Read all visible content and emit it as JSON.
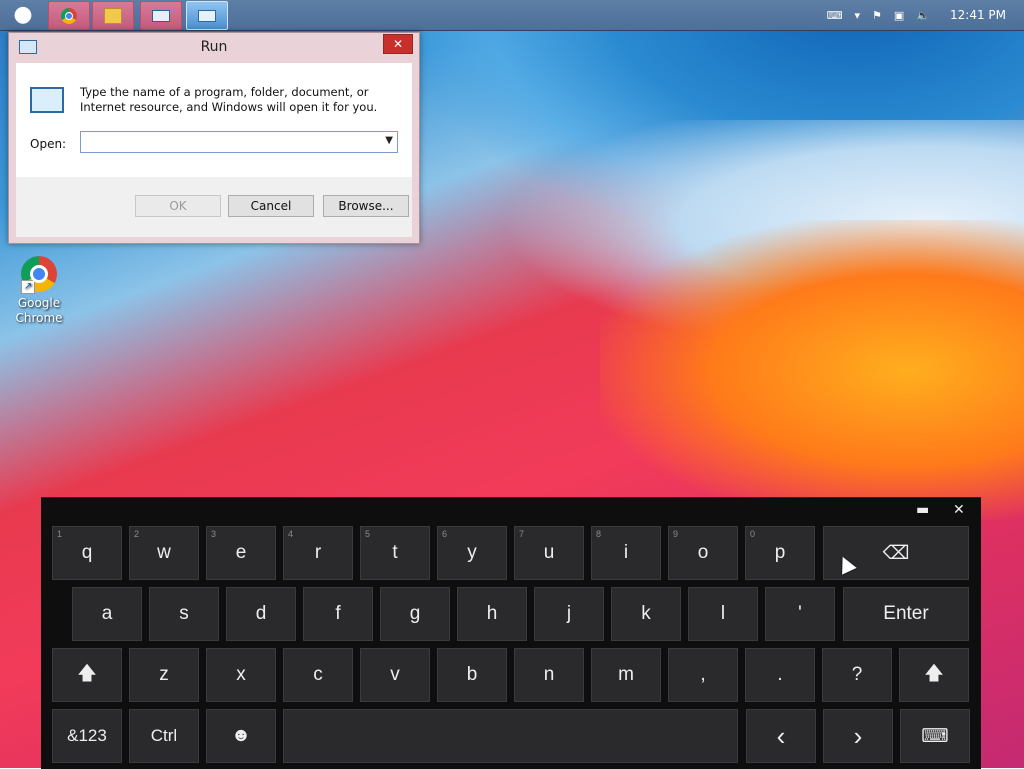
{
  "taskbar": {
    "clock": "12:41 PM",
    "tray_icons": [
      "keyboard-icon",
      "chevron-up-icon",
      "flag-icon",
      "network-icon",
      "volume-muted-icon"
    ]
  },
  "desktop": {
    "icons": [
      {
        "label_line1": "Google",
        "label_line2": "Chrome"
      }
    ]
  },
  "run_dialog": {
    "title": "Run",
    "description": "Type the name of a program, folder, document, or Internet resource, and Windows will open it for you.",
    "open_label": "Open:",
    "open_value": "",
    "ok_label": "OK",
    "cancel_label": "Cancel",
    "browse_label": "Browse..."
  },
  "keyboard": {
    "row1": [
      {
        "label": "q",
        "num": "1"
      },
      {
        "label": "w",
        "num": "2"
      },
      {
        "label": "e",
        "num": "3"
      },
      {
        "label": "r",
        "num": "4"
      },
      {
        "label": "t",
        "num": "5"
      },
      {
        "label": "y",
        "num": "6"
      },
      {
        "label": "u",
        "num": "7"
      },
      {
        "label": "i",
        "num": "8"
      },
      {
        "label": "o",
        "num": "9"
      },
      {
        "label": "p",
        "num": "0"
      }
    ],
    "row2": [
      {
        "label": "a"
      },
      {
        "label": "s"
      },
      {
        "label": "d"
      },
      {
        "label": "f"
      },
      {
        "label": "g"
      },
      {
        "label": "h"
      },
      {
        "label": "j"
      },
      {
        "label": "k"
      },
      {
        "label": "l"
      },
      {
        "label": "'"
      }
    ],
    "row3": [
      {
        "label": "z"
      },
      {
        "label": "x"
      },
      {
        "label": "c"
      },
      {
        "label": "v"
      },
      {
        "label": "b"
      },
      {
        "label": "n"
      },
      {
        "label": "m"
      },
      {
        "label": ","
      },
      {
        "label": "."
      },
      {
        "label": "?"
      }
    ],
    "enter_label": "Enter",
    "symbols_label": "&123",
    "ctrl_label": "Ctrl",
    "emoji_glyph": "☻",
    "left_glyph": "‹",
    "right_glyph": "›",
    "shift_glyph": "🡅",
    "backspace_glyph": "⌫",
    "close_glyph": "✕"
  }
}
